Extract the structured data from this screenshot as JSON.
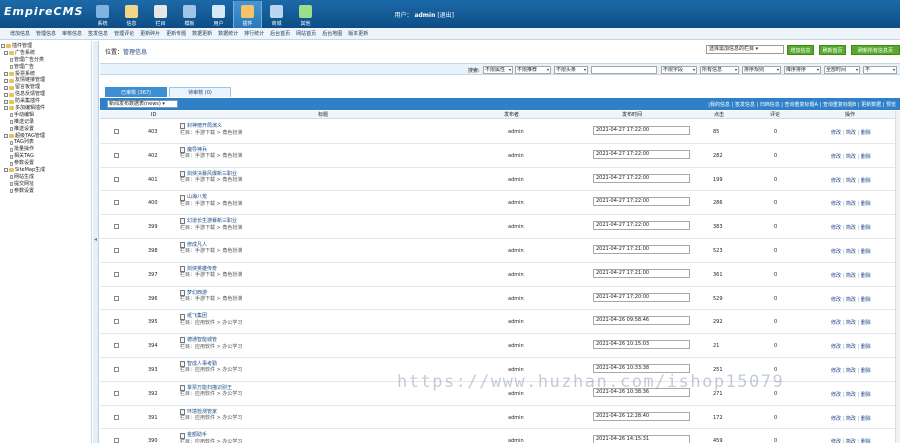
{
  "header": {
    "logo_main": "EmpireCMS",
    "nav": [
      {
        "label": "系统",
        "icon": "gear-icon",
        "color": "#7fb3e0"
      },
      {
        "label": "信息",
        "icon": "edit-icon",
        "color": "#f2d38a"
      },
      {
        "label": "栏目",
        "icon": "folder-icon",
        "color": "#e6e6e6"
      },
      {
        "label": "模板",
        "icon": "template-icon",
        "color": "#9fc4e8"
      },
      {
        "label": "用户",
        "icon": "user-icon",
        "color": "#d7e8f5"
      },
      {
        "label": "插件",
        "icon": "tools-icon",
        "color": "#f5c36a"
      },
      {
        "label": "商城",
        "icon": "shop-icon",
        "color": "#b8d6f0"
      },
      {
        "label": "其他",
        "icon": "grid-icon",
        "color": "#9adf8a"
      }
    ],
    "user_prefix": "用户：",
    "user_name": "admin",
    "logout": "[退出]"
  },
  "submenu": [
    "增加信息",
    "管理信息",
    "审核信息",
    "签发信息",
    "管理评论",
    "更新碎片",
    "更新专题",
    "数据更新",
    "数据统计",
    "排行统计",
    "后台首页",
    "网站首页",
    "后台地图",
    "版本更新"
  ],
  "sidebar": [
    {
      "label": "插件管理",
      "type": "root",
      "indent": 0
    },
    {
      "label": "广告系统",
      "type": "folder",
      "indent": 1
    },
    {
      "label": "管理广告分类",
      "type": "doc",
      "indent": 3
    },
    {
      "label": "管理广告",
      "type": "doc",
      "indent": 3
    },
    {
      "label": "投票系统",
      "type": "folder",
      "indent": 1
    },
    {
      "label": "友情链接管理",
      "type": "folder",
      "indent": 1
    },
    {
      "label": "留言板管理",
      "type": "folder",
      "indent": 1
    },
    {
      "label": "信息反馈管理",
      "type": "folder",
      "indent": 1
    },
    {
      "label": "防采集插件",
      "type": "folder",
      "indent": 1
    },
    {
      "label": "多加编辑插件",
      "type": "folder",
      "indent": 1
    },
    {
      "label": "手动编辑",
      "type": "doc",
      "indent": 3
    },
    {
      "label": "推送记录",
      "type": "doc",
      "indent": 3
    },
    {
      "label": "推送设置",
      "type": "doc",
      "indent": 3
    },
    {
      "label": "超级TAG管理",
      "type": "folder",
      "indent": 1
    },
    {
      "label": "TAG列表",
      "type": "doc",
      "indent": 3
    },
    {
      "label": "批量操作",
      "type": "doc",
      "indent": 3
    },
    {
      "label": "相关TAG",
      "type": "doc",
      "indent": 3
    },
    {
      "label": "参数设置",
      "type": "doc",
      "indent": 3
    },
    {
      "label": "SiteMap生成",
      "type": "folder",
      "indent": 1
    },
    {
      "label": "网站生成",
      "type": "doc",
      "indent": 3
    },
    {
      "label": "提交网址",
      "type": "doc",
      "indent": 3
    },
    {
      "label": "参数设置",
      "type": "doc",
      "indent": 3
    }
  ],
  "main": {
    "loc_label": "位置：",
    "loc_link": "管理信息",
    "column_select": "选择需加信息的栏目",
    "buttons": [
      "增加信息",
      "刷新首页",
      "刷新所有信息页"
    ],
    "search": {
      "label": "搜索:",
      "field1": "不限属性",
      "field2": "不限推荐",
      "field3": "不限头条",
      "field5": "不限字段",
      "field6": "所有信息",
      "field7": "排序规则",
      "field8": "降序排序",
      "field9": "全部时间",
      "field10": "不"
    },
    "tabs": [
      "已审核 (367)",
      "待审核 (0)"
    ],
    "table_select": "新闻发布数据表(news)",
    "top_links": "|我的信息 | 签发信息 | 归档信息 | 查询重复标题A | 查询重复标题B | 更新数据 | 预览",
    "headers": {
      "id": "ID",
      "title": "标题",
      "user": "发布者",
      "date": "发布时间",
      "hits": "点击",
      "cmt": "评论",
      "ops": "操作"
    }
  },
  "rows": [
    {
      "id": "403",
      "title": "封神榜开局演义",
      "cat": "栏目：手游下载 > 角色扮演",
      "user": "admin",
      "date": "2021-04-27 17:22:00",
      "hits": "85",
      "cmt": "0"
    },
    {
      "id": "402",
      "title": "魔导神兵",
      "cat": "栏目：手游下载 > 角色扮演",
      "user": "admin",
      "date": "2021-04-27 17:22:00",
      "hits": "282",
      "cmt": "0"
    },
    {
      "id": "401",
      "title": "剑侠决暴风爆新三职业",
      "cat": "栏目：手游下载 > 角色扮演",
      "user": "admin",
      "date": "2021-04-27 17:22:00",
      "hits": "199",
      "cmt": "0"
    },
    {
      "id": "400",
      "title": "山海八荒",
      "cat": "栏目：手游下载 > 角色扮演",
      "user": "admin",
      "date": "2021-04-27 17:22:00",
      "hits": "286",
      "cmt": "0"
    },
    {
      "id": "399",
      "title": "幻道长生游暴新三职业",
      "cat": "栏目：手游下载 > 角色扮演",
      "user": "admin",
      "date": "2021-04-27 17:22:00",
      "hits": "383",
      "cmt": "0"
    },
    {
      "id": "398",
      "title": "修成凡人",
      "cat": "栏目：手游下载 > 角色扮演",
      "user": "admin",
      "date": "2021-04-27 17:21:00",
      "hits": "523",
      "cmt": "0"
    },
    {
      "id": "397",
      "title": "剑侠英雄传奇",
      "cat": "栏目：手游下载 > 角色扮演",
      "user": "admin",
      "date": "2021-04-27 17:21:00",
      "hits": "361",
      "cmt": "0"
    },
    {
      "id": "396",
      "title": "梦幻西游",
      "cat": "栏目：手游下载 > 角色扮演",
      "user": "admin",
      "date": "2021-04-27 17:20:00",
      "hits": "529",
      "cmt": "0"
    },
    {
      "id": "395",
      "title": "纸飞集团",
      "cat": "栏目：应用软件 > 办公学习",
      "user": "admin",
      "date": "2021-04-26 09:58:46",
      "hits": "292",
      "cmt": "0"
    },
    {
      "id": "394",
      "title": "德通智能城管",
      "cat": "栏目：应用软件 > 办公学习",
      "user": "admin",
      "date": "2021-04-26 10:15:03",
      "hits": "21",
      "cmt": "0"
    },
    {
      "id": "393",
      "title": "智成人事考勤",
      "cat": "栏目：应用软件 > 办公学习",
      "user": "admin",
      "date": "2021-04-26 10:33:38",
      "hits": "251",
      "cmt": "0"
    },
    {
      "id": "392",
      "title": "掌票万能扫描识别王",
      "cat": "栏目：应用软件 > 办公学习",
      "user": "admin",
      "date": "2021-04-26 10:38:36",
      "hits": "271",
      "cmt": "0"
    },
    {
      "id": "391",
      "title": "环境检测管家",
      "cat": "栏目：应用软件 > 办公学习",
      "user": "admin",
      "date": "2021-04-26 12:28:40",
      "hits": "172",
      "cmt": "0"
    },
    {
      "id": "390",
      "title": "金额助手",
      "cat": "栏目：应用软件 > 办公学习",
      "user": "admin",
      "date": "2021-04-26 14:15:31",
      "hits": "459",
      "cmt": "0"
    }
  ],
  "ops": {
    "edit": "修改",
    "sep": "|",
    "simple": "简改",
    "del": "删除"
  },
  "watermark": "https://www.huzhan.com/ishop15079"
}
